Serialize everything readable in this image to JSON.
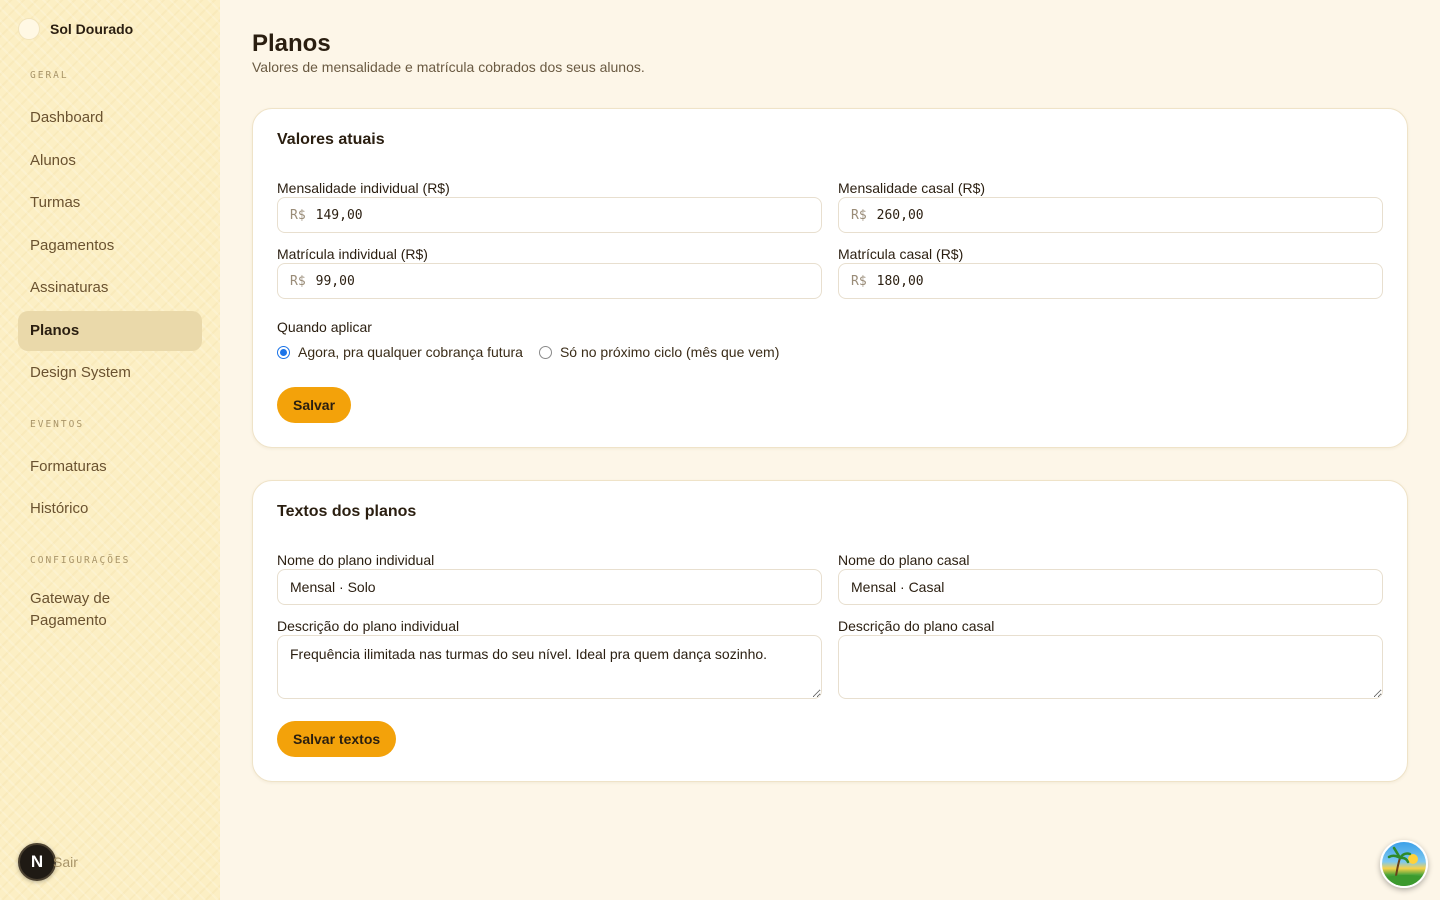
{
  "brand": {
    "name": "Sol Dourado"
  },
  "sidebar": {
    "sections": [
      {
        "label": "GERAL",
        "items": [
          "Dashboard",
          "Alunos",
          "Turmas",
          "Pagamentos",
          "Assinaturas",
          "Planos",
          "Design System"
        ]
      },
      {
        "label": "EVENTOS",
        "items": [
          "Formaturas",
          "Histórico"
        ]
      },
      {
        "label": "CONFIGURAÇÕES",
        "items": [
          "Gateway de Pagamento"
        ]
      }
    ],
    "active": "Planos",
    "logout_label": "Sair",
    "avatar_letter": "N"
  },
  "page": {
    "title": "Planos",
    "subtitle": "Valores de mensalidade e matrícula cobrados dos seus alunos."
  },
  "values_card": {
    "title": "Valores atuais",
    "currency_prefix": "R$",
    "fields": {
      "monthly_individual": {
        "label": "Mensalidade individual (R$)",
        "value": "149,00"
      },
      "monthly_couple": {
        "label": "Mensalidade casal (R$)",
        "value": "260,00"
      },
      "enroll_individual": {
        "label": "Matrícula individual (R$)",
        "value": "99,00"
      },
      "enroll_couple": {
        "label": "Matrícula casal (R$)",
        "value": "180,00"
      }
    },
    "apply_label": "Quando aplicar",
    "apply_options": [
      {
        "label": "Agora, pra qualquer cobrança futura",
        "checked": true
      },
      {
        "label": "Só no próximo ciclo (mês que vem)",
        "checked": false
      }
    ],
    "save_label": "Salvar"
  },
  "texts_card": {
    "title": "Textos dos planos",
    "fields": {
      "name_individual": {
        "label": "Nome do plano individual",
        "value": "Mensal · Solo"
      },
      "name_couple": {
        "label": "Nome do plano casal",
        "value": "Mensal · Casal"
      },
      "desc_individual": {
        "label": "Descrição do plano individual",
        "value": "Frequência ilimitada nas turmas do seu nível. Ideal pra quem dança sozinho."
      },
      "desc_couple": {
        "label": "Descrição do plano casal",
        "value": ""
      }
    },
    "save_label": "Salvar textos"
  },
  "colors": {
    "accent": "#f3a20a",
    "sidebar_bg": "#fcefc4",
    "active_nav_bg": "#ead9aa",
    "page_bg": "#fdf6e8"
  },
  "icons": {
    "brand": "sun-logo-icon",
    "floating": "beach-palm-avatar-icon"
  }
}
